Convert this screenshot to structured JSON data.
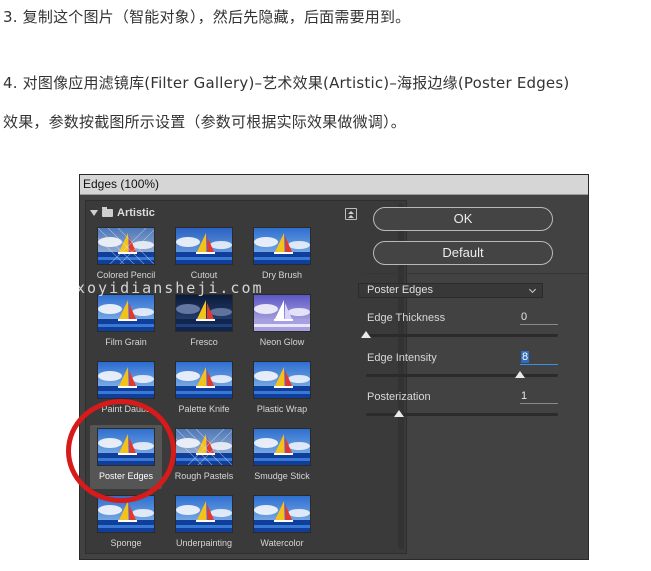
{
  "article": {
    "line1": "3. 复制这个图片（智能对象），然后先隐藏，后面需要用到。",
    "line2": "4. 对图像应用滤镜库(Filter Gallery)–艺术效果(Artistic)–海报边缘(Poster Edges)",
    "line3": "效果，参数按截图所示设置（参数可根据实际效果做微调）。"
  },
  "dialog": {
    "title": "Edges (100%)",
    "folder": "Artistic",
    "thumbnails": [
      {
        "label": "Colored Pencil",
        "style": "pencil"
      },
      {
        "label": "Cutout",
        "style": "cutout"
      },
      {
        "label": "Dry Brush",
        "style": "normal"
      },
      {
        "label": "Film Grain",
        "style": "normal"
      },
      {
        "label": "Fresco",
        "style": "dark"
      },
      {
        "label": "Neon Glow",
        "style": "neon"
      },
      {
        "label": "Paint Daubs",
        "style": "daubs"
      },
      {
        "label": "Palette Knife",
        "style": "normal"
      },
      {
        "label": "Plastic Wrap",
        "style": "normal"
      },
      {
        "label": "Poster Edges",
        "style": "normal"
      },
      {
        "label": "Rough Pastels",
        "style": "pencil"
      },
      {
        "label": "Smudge Stick",
        "style": "normal"
      },
      {
        "label": "Sponge",
        "style": "normal"
      },
      {
        "label": "Underpainting",
        "style": "normal"
      },
      {
        "label": "Watercolor",
        "style": "normal"
      }
    ],
    "selected_index": 9,
    "ok_label": "OK",
    "default_label": "Default",
    "filter_select": "Poster Edges",
    "params": [
      {
        "label": "Edge Thickness",
        "value": "0",
        "fraction": 0.0
      },
      {
        "label": "Edge Intensity",
        "value": "8",
        "fraction": 0.8
      },
      {
        "label": "Posterization",
        "value": "1",
        "fraction": 0.17
      }
    ]
  },
  "watermark": "xoyidiansheji.com",
  "colors": {
    "dialog_bg": "#424242",
    "highlight": "#d71a1a",
    "focus_blue": "#3d8fe6"
  }
}
